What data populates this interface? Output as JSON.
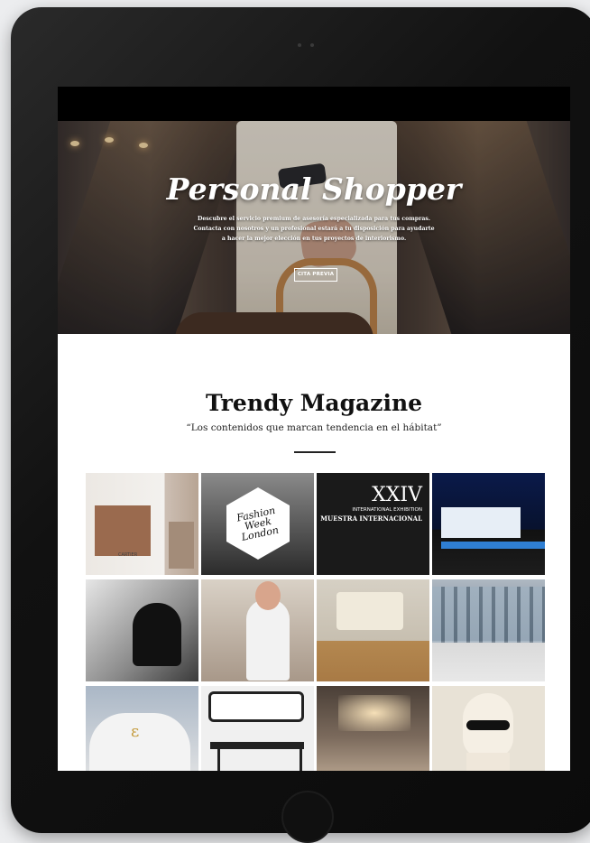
{
  "hero": {
    "title": "Personal Shopper",
    "description": "Descubre el servicio premium de asesoría especializada para tus compras. Contacta con nosotros y un profesional estará a tu disposición para ayudarte a hacer la mejor elección en tus proyectos de interiorismo.",
    "cta_label": "CITA PREVIA"
  },
  "magazine": {
    "title": "Trendy Magazine",
    "subtitle": "“Los contenidos que marcan tendencia en el hábitat”",
    "tiles": [
      {
        "text": "CARTIER"
      },
      {
        "text": "Fashion Week London"
      },
      {
        "text_big": "XXIV",
        "text_line1": "INTERNATIONAL EXHIBITION",
        "text_line2": "MUESTRA INTERNACIONAL"
      },
      {},
      {},
      {},
      {},
      {},
      {},
      {},
      {},
      {}
    ]
  }
}
